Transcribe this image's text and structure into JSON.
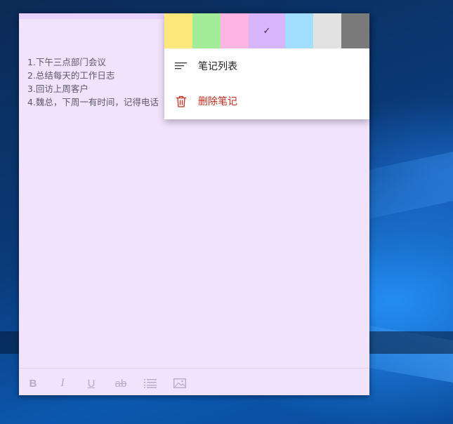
{
  "note": {
    "lines": [
      "1.下午三点部门会议",
      "2.总结每天的工作日志",
      "3.回访上周客户",
      "4.魏总，下周一有时间，记得电话"
    ]
  },
  "menu": {
    "swatches": [
      {
        "name": "yellow",
        "color": "#fee77b",
        "selected": false
      },
      {
        "name": "green",
        "color": "#a2eb97",
        "selected": false
      },
      {
        "name": "pink",
        "color": "#fdb4e4",
        "selected": false
      },
      {
        "name": "purple",
        "color": "#d8b4fb",
        "selected": true
      },
      {
        "name": "blue",
        "color": "#a0ddfe",
        "selected": false
      },
      {
        "name": "gray",
        "color": "#e1e1e1",
        "selected": false
      },
      {
        "name": "charcoal",
        "color": "#7a7a7a",
        "selected": false
      }
    ],
    "check_glyph": "✓",
    "notes_list_label": "笔记列表",
    "delete_label": "删除笔记",
    "delete_color": "#c42b1c"
  },
  "toolbar": {
    "bold_label": "B",
    "italic_label": "I",
    "underline_label": "U",
    "strike_label": "ab",
    "icons": [
      "bold-icon",
      "italic-icon",
      "underline-icon",
      "strikethrough-icon",
      "bullet-list-icon",
      "image-icon"
    ]
  },
  "colors": {
    "note_background": "#f2e3fd",
    "toolbar_icon": "#b6a9c5"
  }
}
